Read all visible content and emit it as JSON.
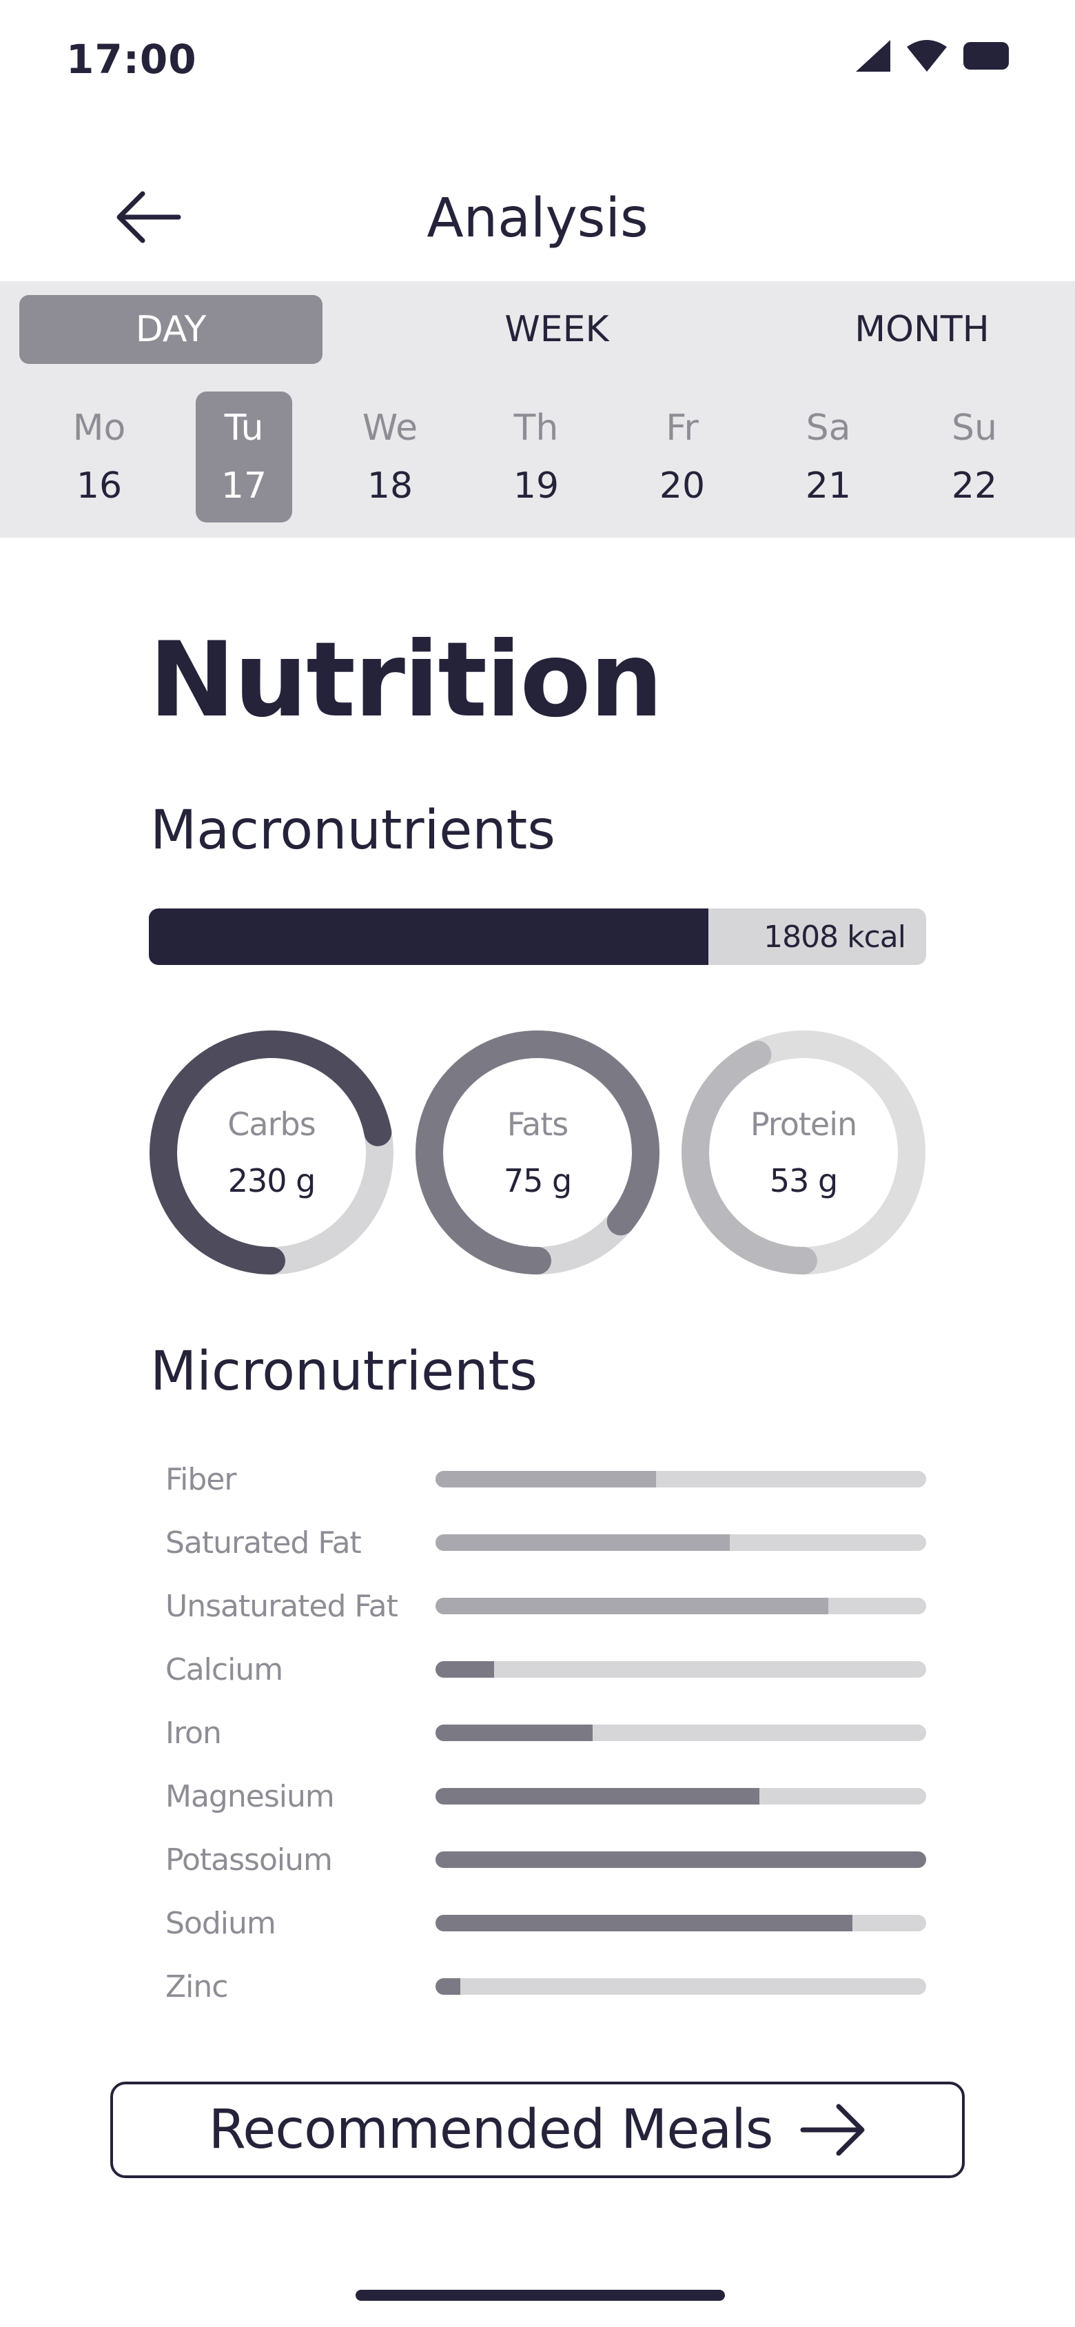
{
  "status_bar": {
    "time": "17:00"
  },
  "header": {
    "title": "Analysis"
  },
  "range_tabs": [
    {
      "label": "DAY",
      "active": true
    },
    {
      "label": "WEEK",
      "active": false
    },
    {
      "label": "MONTH",
      "active": false
    }
  ],
  "days": [
    {
      "dow": "Mo",
      "num": "16",
      "active": false
    },
    {
      "dow": "Tu",
      "num": "17",
      "active": true
    },
    {
      "dow": "We",
      "num": "18",
      "active": false
    },
    {
      "dow": "Th",
      "num": "19",
      "active": false
    },
    {
      "dow": "Fr",
      "num": "20",
      "active": false
    },
    {
      "dow": "Sa",
      "num": "21",
      "active": false
    },
    {
      "dow": "Su",
      "num": "22",
      "active": false
    }
  ],
  "nutrition": {
    "title": "Nutrition",
    "macros_title": "Macronutrients",
    "calories": {
      "label": "1808 kcal",
      "progress": 0.72
    },
    "macros": [
      {
        "name": "Carbs",
        "value": "230 g",
        "progress": 0.72,
        "color": "#4e4c5c",
        "track": "#d6d6d9"
      },
      {
        "name": "Fats",
        "value": "75 g",
        "progress": 0.86,
        "color": "#7b7a84",
        "track": "#d6d6d9"
      },
      {
        "name": "Protein",
        "value": "53 g",
        "progress": 0.43,
        "color": "#b9b9bd",
        "track": "#dededf"
      }
    ],
    "micros_title": "Micronutrients",
    "micros": [
      {
        "name": "Fiber",
        "progress": 0.45,
        "color": "#a9a8ae"
      },
      {
        "name": "Saturated Fat",
        "progress": 0.6,
        "color": "#a9a8ae"
      },
      {
        "name": "Unsaturated Fat",
        "progress": 0.8,
        "color": "#a9a8ae"
      },
      {
        "name": "Calcium",
        "progress": 0.12,
        "color": "#7b7a84"
      },
      {
        "name": "Iron",
        "progress": 0.32,
        "color": "#7b7a84"
      },
      {
        "name": "Magnesium",
        "progress": 0.66,
        "color": "#7b7a84"
      },
      {
        "name": "Potassoium",
        "progress": 1.0,
        "color": "#7b7a84"
      },
      {
        "name": "Sodium",
        "progress": 0.85,
        "color": "#7b7a84"
      },
      {
        "name": "Zinc",
        "progress": 0.05,
        "color": "#7b7a84"
      }
    ]
  },
  "cta": {
    "label": "Recommended Meals"
  },
  "icons": {
    "back": "arrow-left-icon",
    "cta": "arrow-right-icon",
    "signal": "signal-icon",
    "wifi": "wifi-icon",
    "battery": "battery-icon"
  }
}
